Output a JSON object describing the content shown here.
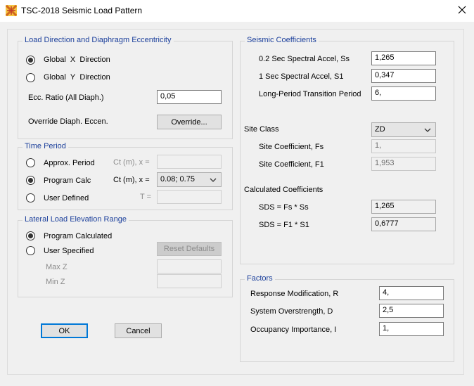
{
  "window": {
    "title": "TSC-2018 Seismic Load Pattern",
    "icon": "etabs-app-icon",
    "close_icon": "close-icon"
  },
  "load_direction": {
    "legend": "Load Direction and Diaphragm Eccentricity",
    "global_x": {
      "label_prefix": "Global",
      "axis": "X",
      "label_suffix": "Direction",
      "selected": true
    },
    "global_y": {
      "label_prefix": "Global",
      "axis": "Y",
      "label_suffix": "Direction",
      "selected": false
    },
    "ecc_ratio_label": "Ecc. Ratio (All Diaph.)",
    "ecc_ratio_value": "0,05",
    "override_label": "Override Diaph. Eccen.",
    "override_button": "Override..."
  },
  "time_period": {
    "legend": "Time Period",
    "approx": {
      "label": "Approx. Period",
      "selected": false,
      "param_label": "Ct (m), x =",
      "value": ""
    },
    "program_calc": {
      "label": "Program Calc",
      "selected": true,
      "param_label": "Ct (m), x =",
      "value": "0.08;  0.75"
    },
    "user_defined": {
      "label": "User Defined",
      "selected": false,
      "param_label": "T =",
      "value": ""
    }
  },
  "elevation_range": {
    "legend": "Lateral Load Elevation Range",
    "program_calculated": {
      "label": "Program Calculated",
      "selected": true
    },
    "user_specified": {
      "label": "User Specified",
      "selected": false
    },
    "reset_button": "Reset Defaults",
    "max_z_label": "Max Z",
    "min_z_label": "Min Z",
    "max_z_value": "",
    "min_z_value": ""
  },
  "buttons": {
    "ok": "OK",
    "cancel": "Cancel"
  },
  "seismic_coefficients": {
    "legend": "Seismic Coefficients",
    "ss_label": "0.2 Sec Spectral Accel, Ss",
    "ss_value": "1,265",
    "s1_label": "1 Sec Spectral Accel, S1",
    "s1_value": "0,347",
    "tl_label": "Long-Period Transition Period",
    "tl_value": "6,",
    "site_class_label": "Site Class",
    "site_class_value": "ZD",
    "fs_label": "Site Coefficient, Fs",
    "fs_value": "1,",
    "f1_label": "Site Coefficient, F1",
    "f1_value": "1,953",
    "calc_heading": "Calculated Coefficients",
    "sds_label": "SDS =  Fs * Ss",
    "sds_value": "1,265",
    "sd1_label": "SDS =  F1 * S1",
    "sd1_value": "0,6777"
  },
  "factors": {
    "legend": "Factors",
    "r_label": "Response Modification, R",
    "r_value": "4,",
    "d_label": "System Overstrength, D",
    "d_value": "2,5",
    "i_label": "Occupancy Importance, I",
    "i_value": "1,"
  },
  "colors": {
    "group_legend": "#1b3f9b",
    "dialog_bg": "#f0f0f0",
    "default_button_border": "#0078d7"
  }
}
